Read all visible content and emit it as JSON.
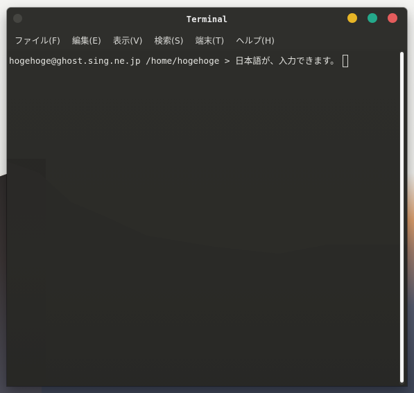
{
  "window": {
    "title": "Terminal"
  },
  "menu": {
    "items": [
      "ファイル(F)",
      "編集(E)",
      "表示(V)",
      "検索(S)",
      "端末(T)",
      "ヘルプ(H)"
    ]
  },
  "terminal": {
    "user_host": "hogehoge@ghost.sing.ne.jp",
    "path": "/home/hogehoge",
    "prompt_symbol": ">",
    "input_text": "日本語が、入力できます。"
  },
  "colors": {
    "close": "#e45c5c",
    "maximize": "#24a98b",
    "minimize": "#e7b526",
    "window_bg": "#2e2e2b",
    "text": "#e0e0dc"
  },
  "icons": {
    "window_menu": "circle-icon"
  }
}
